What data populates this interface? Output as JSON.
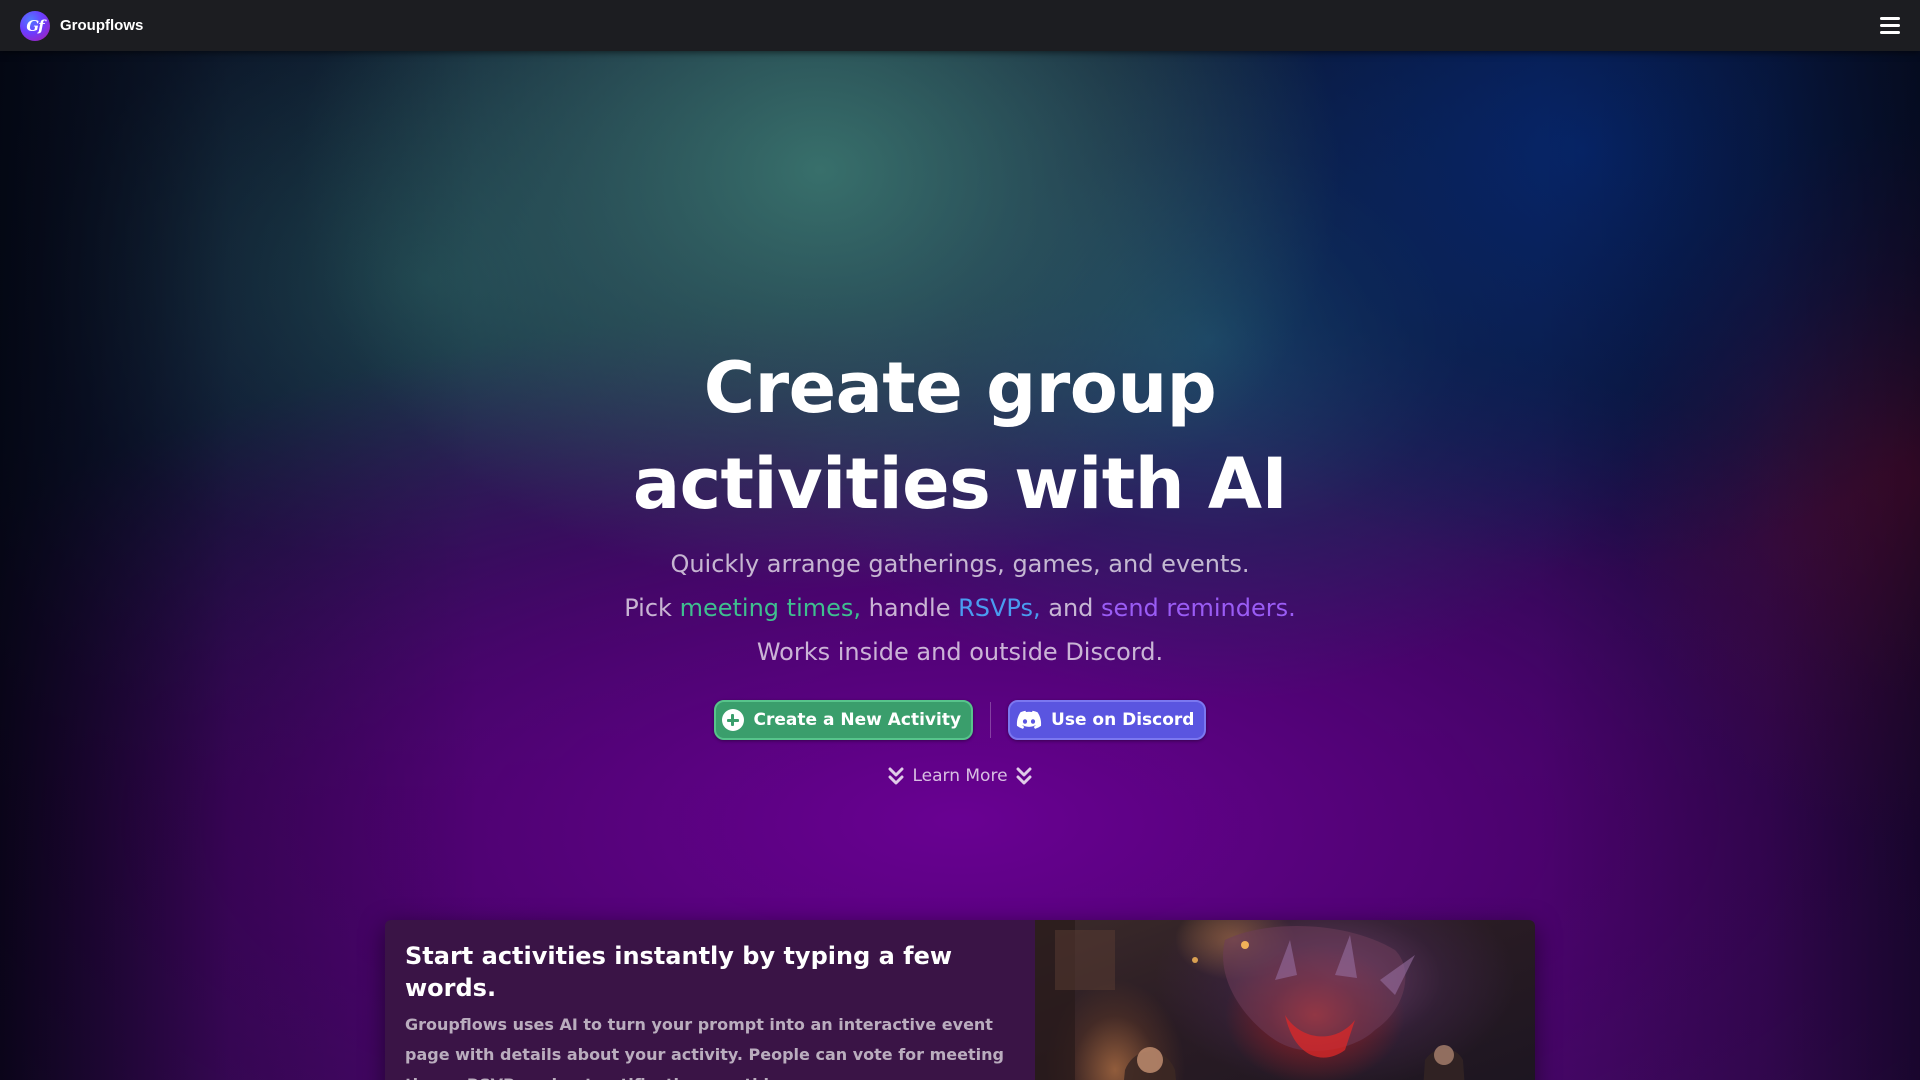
{
  "app": {
    "name": "Groupflows",
    "logo_text": "Gf"
  },
  "header": {
    "menu_icon": "hamburger-menu-icon"
  },
  "hero": {
    "title_line1": "Create group",
    "title_line2": "activities with AI",
    "subtitle_line1": "Quickly arrange gatherings, games, and events.",
    "subtitle_line2": {
      "pick": "Pick",
      "meeting_times": "meeting times,",
      "handle": "handle",
      "rsvps": "RSVPs,",
      "and": "and",
      "send_reminders": "send reminders."
    },
    "subtitle_line3": "Works inside and outside Discord."
  },
  "actions": {
    "create_label": "Create a New Activity",
    "create_icon": "plus-circle-icon",
    "discord_label": "Use on Discord",
    "discord_icon": "discord-icon",
    "learn_more_label": "Learn More",
    "learn_more_icon": "double-chevron-down-icon"
  },
  "feature": {
    "title": "Start activities instantly by typing a few words.",
    "body": "Groupflows uses AI to turn your prompt into an interactive event page with details about your activity. People can vote for meeting times, RSVP, and get notifications on this page."
  },
  "colors": {
    "topbar": "#1c1d21",
    "create_button": "#3a9e6c",
    "discord_button": "#5a55e0",
    "highlight_green": "#3fbf8f",
    "highlight_blue": "#4a9cf0",
    "highlight_purple": "#9a5cf5",
    "card_background": "#3a1446"
  }
}
